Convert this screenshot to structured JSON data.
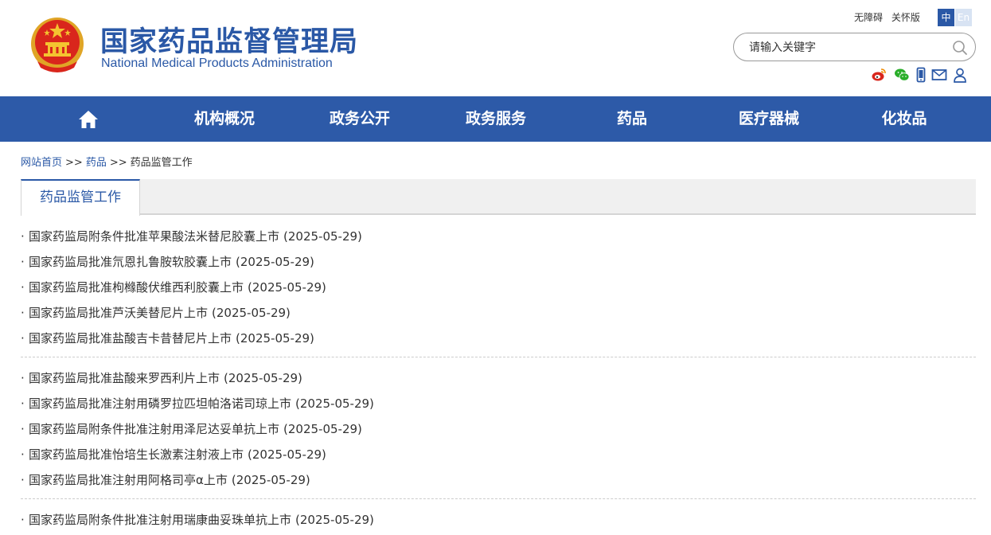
{
  "header": {
    "title_cn": "国家药品监督管理局",
    "title_en": "National Medical Products Administration",
    "accessibility_link": "无障碍",
    "elder_link": "关怀版",
    "lang_zh": "中",
    "lang_en": "En",
    "search_placeholder": "请输入关键字",
    "social_icons": [
      "weibo-icon",
      "wechat-icon",
      "mobile-icon",
      "mail-icon",
      "user-icon"
    ]
  },
  "nav": {
    "home_icon": "home-icon",
    "items": [
      "机构概况",
      "政务公开",
      "政务服务",
      "药品",
      "医疗器械",
      "化妆品"
    ]
  },
  "breadcrumb": {
    "home": "网站首页",
    "separator": ">>",
    "level1": "药品",
    "current": "药品监管工作"
  },
  "tab": {
    "label": "药品监管工作"
  },
  "list": {
    "groups": [
      [
        {
          "title": "国家药监局附条件批准苹果酸法米替尼胶囊上市",
          "date": "(2025-05-29)"
        },
        {
          "title": "国家药监局批准氘恩扎鲁胺软胶囊上市",
          "date": "(2025-05-29)"
        },
        {
          "title": "国家药监局批准枸橼酸伏维西利胶囊上市",
          "date": "(2025-05-29)"
        },
        {
          "title": "国家药监局批准芦沃美替尼片上市",
          "date": "(2025-05-29)"
        },
        {
          "title": "国家药监局批准盐酸吉卡昔替尼片上市",
          "date": "(2025-05-29)"
        }
      ],
      [
        {
          "title": "国家药监局批准盐酸来罗西利片上市",
          "date": "(2025-05-29)"
        },
        {
          "title": "国家药监局批准注射用磷罗拉匹坦帕洛诺司琼上市",
          "date": "(2025-05-29)"
        },
        {
          "title": "国家药监局附条件批准注射用泽尼达妥单抗上市",
          "date": "(2025-05-29)"
        },
        {
          "title": "国家药监局批准怡培生长激素注射液上市",
          "date": "(2025-05-29)"
        },
        {
          "title": "国家药监局批准注射用阿格司亭α上市",
          "date": "(2025-05-29)"
        }
      ],
      [
        {
          "title": "国家药监局附条件批准注射用瑞康曲妥珠单抗上市",
          "date": "(2025-05-29)"
        }
      ]
    ]
  },
  "colors": {
    "brand_blue": "#2a58a6",
    "nav_blue": "#2d5aa8",
    "emblem_red": "#d9261c",
    "emblem_gold": "#f4c430"
  }
}
